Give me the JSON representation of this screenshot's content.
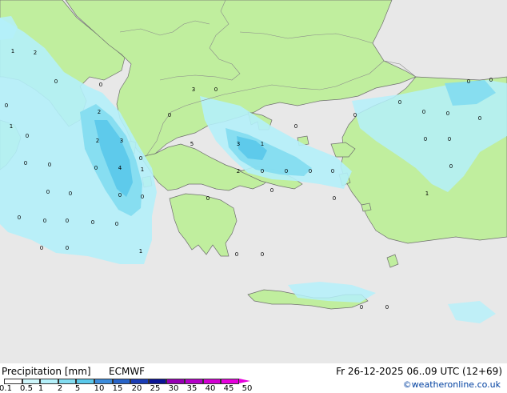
{
  "map": {
    "region": "Greece and Aegean",
    "colors": {
      "sea": "#e8e8e8",
      "land": "#c0ee9e",
      "border": "#8a8a8a",
      "coast": "#6f6f6f",
      "precip_light": "#b4f0fa",
      "precip_mid": "#82dcf0",
      "precip_heavy": "#5ac8ea"
    },
    "value_labels": [
      "1",
      "2",
      "0",
      "0",
      "0",
      "1",
      "0",
      "2",
      "3",
      "2",
      "0",
      "0",
      "0",
      "4",
      "1",
      "0",
      "0",
      "0",
      "0",
      "0",
      "0",
      "0",
      "0",
      "0",
      "0",
      "0",
      "1",
      "0",
      "5",
      "3",
      "0",
      "3",
      "1",
      "2",
      "0",
      "0",
      "0",
      "0",
      "0",
      "0",
      "0",
      "0",
      "0",
      "0",
      "1",
      "0",
      "0",
      "0",
      "0",
      "0",
      "0",
      "0",
      "0",
      "0",
      "0",
      "0",
      "0",
      "0"
    ]
  },
  "footer": {
    "title": "Precipitation [mm]",
    "model": "ECMWF",
    "datetime": "Fr 26-12-2025 06..09 UTC (12+69)",
    "credit": "©weatheronline.co.uk",
    "scale_labels": [
      "0.1",
      "0.5",
      "1",
      "2",
      "5",
      "10",
      "15",
      "20",
      "25",
      "30",
      "35",
      "40",
      "45",
      "50"
    ],
    "scale_colors": [
      "#ffffff",
      "#cdf6fb",
      "#b4f0fa",
      "#82dcf0",
      "#5ac8ea",
      "#3c8cdc",
      "#2864c8",
      "#1a3cb4",
      "#0a1496",
      "#9600b4",
      "#b400c8",
      "#d200d2",
      "#e600dc"
    ]
  }
}
